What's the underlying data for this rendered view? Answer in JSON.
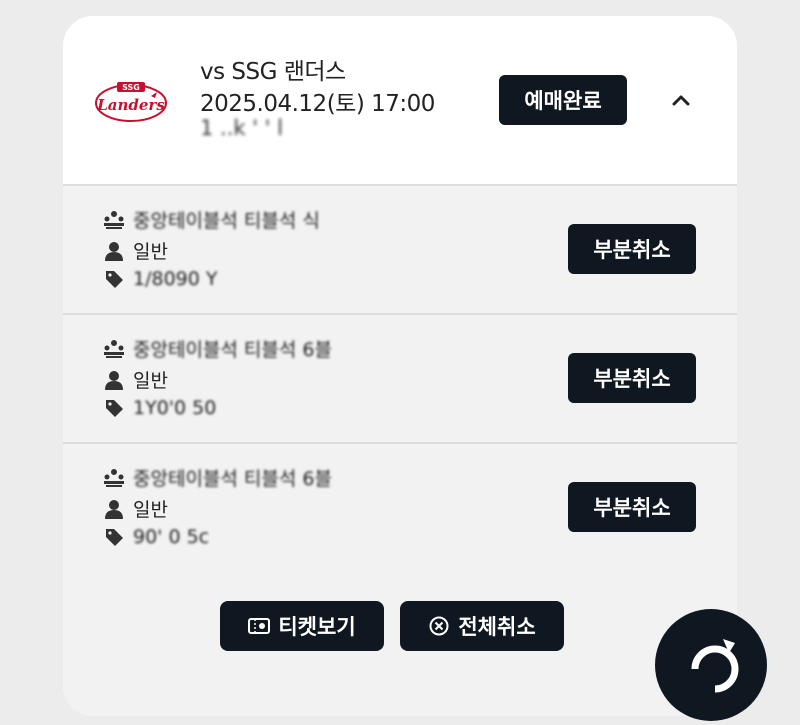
{
  "game": {
    "title": "vs SSG 랜더스",
    "datetime": "2025.04.12(토) 17:00",
    "venue": "1 ..k ' '   l",
    "status": "예매완료",
    "logo_text": "SSG",
    "logo_script": "Landers"
  },
  "seats": [
    {
      "section": "중앙테이블석 티블석 식",
      "ticket_type": "일반",
      "ticket_no": "1/8090  Y",
      "cancel_label": "부분취소"
    },
    {
      "section": "중앙테이블석 티블석 6블",
      "ticket_type": "일반",
      "ticket_no": "1Y0'0  50",
      "cancel_label": "부분취소"
    },
    {
      "section": "중앙테이블석 티블석 6블",
      "ticket_type": "일반",
      "ticket_no": "90' 0  5c",
      "cancel_label": "부분취소"
    }
  ],
  "footer": {
    "view_ticket_label": "티켓보기",
    "cancel_all_label": "전체취소"
  },
  "colors": {
    "button_bg": "#0f1720",
    "background": "#ececec",
    "row_bg": "#f2f2f2",
    "logo_red": "#c8102e"
  },
  "icons": {
    "seat": "seat-icon",
    "person": "person-icon",
    "ticket": "ticket-tag-icon",
    "chevron": "chevron-up-icon",
    "ticket_view": "ticket-icon",
    "cancel": "close-circle-icon"
  }
}
